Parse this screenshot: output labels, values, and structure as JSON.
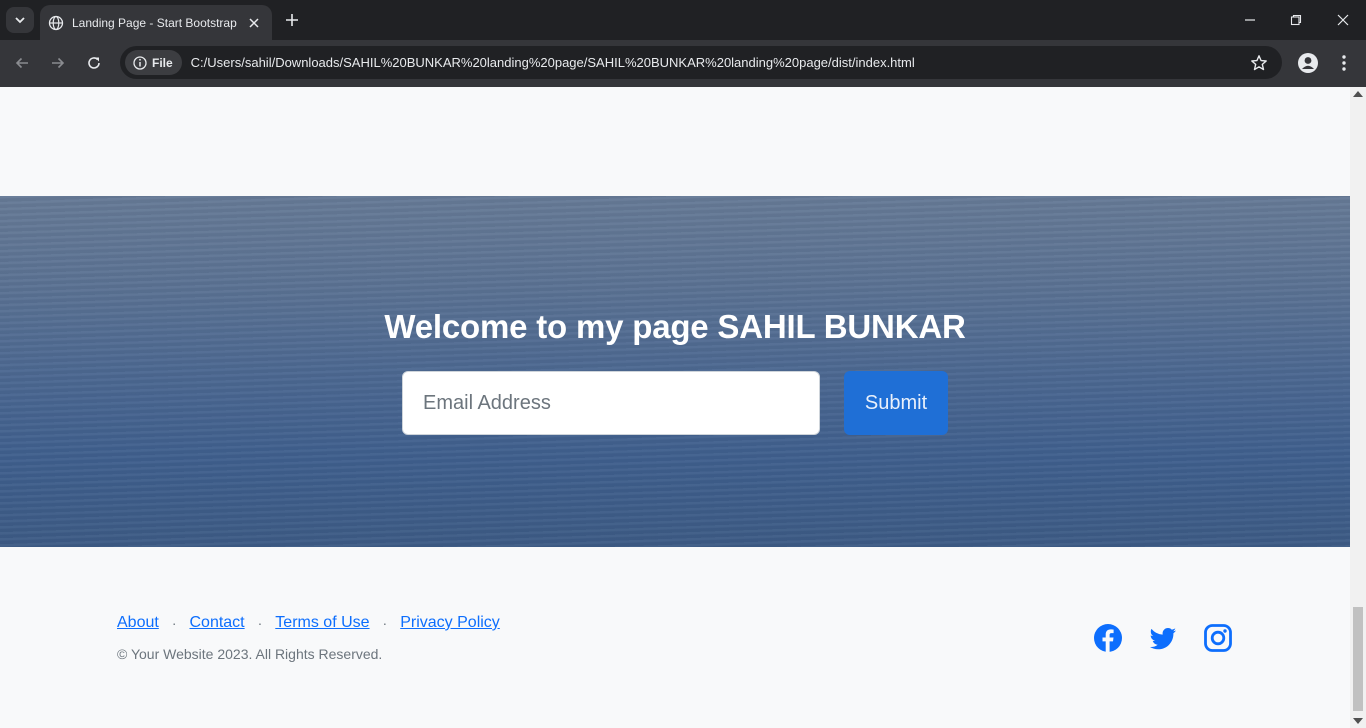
{
  "browser": {
    "tab_title": "Landing Page - Start Bootstrap",
    "site_chip": "File",
    "url": "C:/Users/sahil/Downloads/SAHIL%20BUNKAR%20landing%20page/SAHIL%20BUNKAR%20landing%20page/dist/index.html",
    "icons": [
      "tab-search-icon",
      "globe-icon",
      "close-icon",
      "plus-icon",
      "minimize-icon",
      "restore-icon",
      "close-window-icon",
      "back-icon",
      "forward-icon",
      "reload-icon",
      "info-icon",
      "star-icon",
      "profile-icon",
      "menu-icon"
    ]
  },
  "cta": {
    "heading": "Welcome to my page SAHIL BUNKAR",
    "email_placeholder": "Email Address",
    "submit_label": "Submit",
    "button_color": "#1f6fd6"
  },
  "footer": {
    "links": [
      "About",
      "Contact",
      "Terms of Use",
      "Privacy Policy"
    ],
    "separator": "·",
    "copyright": "© Your Website 2023. All Rights Reserved.",
    "social": [
      "facebook-icon",
      "twitter-icon",
      "instagram-icon"
    ],
    "link_color": "#0d6efd"
  }
}
